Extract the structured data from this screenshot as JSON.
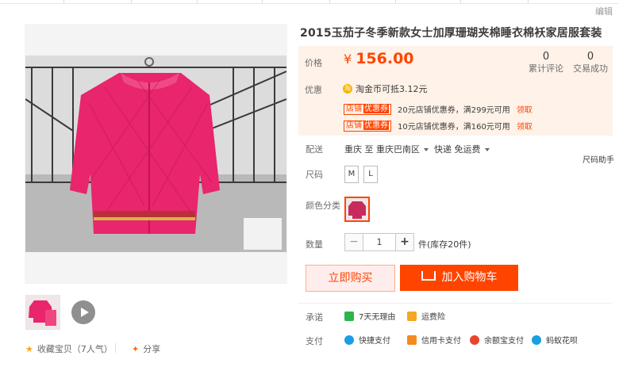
{
  "topbar": {
    "edit_label": "编辑"
  },
  "product": {
    "title": "2015玉茄子冬季新款女士加厚珊瑚夹棉睡衣棉袄家居服套装",
    "price_label": "价格",
    "currency": "¥",
    "price": "156.00",
    "reviews_count": "0",
    "reviews_label": "累计评论",
    "trades_count": "0",
    "trades_label": "交易成功"
  },
  "promo": {
    "label": "优惠",
    "coin_icon": "taojinbi-icon",
    "coin_text": "淘金币可抵3.12元",
    "coupons": [
      {
        "tag": "店铺",
        "tag_highlight": "优惠券",
        "text": "20元店铺优惠券，满299元可用",
        "action": "领取"
      },
      {
        "tag": "店铺",
        "tag_highlight": "优惠券",
        "text": "10元店铺优惠券，满160元可用",
        "action": "领取"
      }
    ]
  },
  "shipping": {
    "label": "配送",
    "from": "重庆 至",
    "to": "重庆巴南区",
    "method": "快递 免运费"
  },
  "size": {
    "label": "尺码",
    "options": [
      "M",
      "L"
    ],
    "helper": "尺码助手"
  },
  "color": {
    "label": "颜色分类"
  },
  "quantity": {
    "label": "数量",
    "value": "1",
    "minus": "−",
    "plus": "+",
    "stock": "件(库存20件)"
  },
  "actions": {
    "buy_now": "立即购买",
    "add_to_cart": "加入购物车"
  },
  "promise": {
    "label": "承诺",
    "items": [
      "7天无理由",
      "运费险"
    ]
  },
  "payment": {
    "label": "支付",
    "items": [
      "快捷支付",
      "信用卡支付",
      "余额宝支付",
      "蚂蚁花呗"
    ]
  },
  "social": {
    "favorite": "收藏宝贝（7人气）",
    "share": "分享"
  },
  "colors": {
    "accent": "#ff4400",
    "price_bg": "#fff2e8"
  }
}
